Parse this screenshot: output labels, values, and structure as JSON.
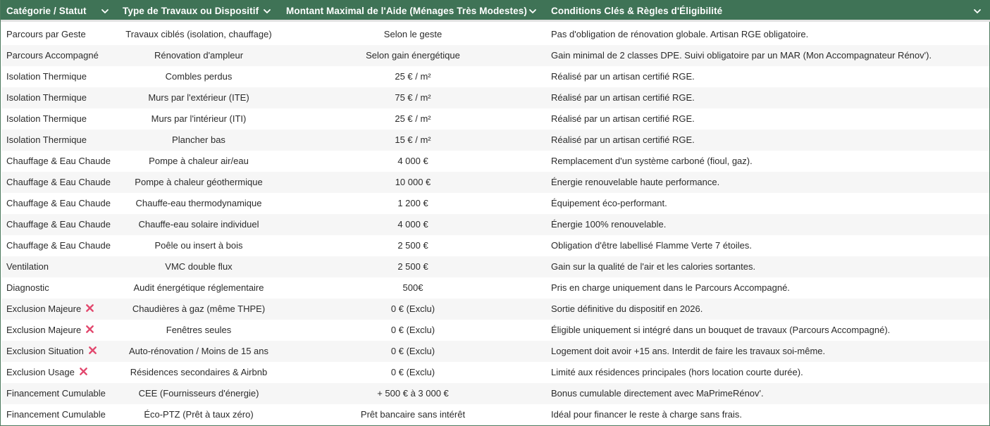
{
  "table": {
    "columns": [
      "Catégorie / Statut",
      "Type de Travaux ou Dispositif",
      "Montant Maximal de l'Aide (Ménages Très Modestes)",
      "Conditions Clés & Règles d'Éligibilité"
    ],
    "header_bg": "#3f7356",
    "exclusion_icon": "cross-mark-icon",
    "exclusion_color": "#e2476d",
    "rows": [
      {
        "category": "Parcours par Geste",
        "work": "Travaux ciblés (isolation, chauffage)",
        "amount": "Selon le geste",
        "conditions": "Pas d'obligation de rénovation globale. Artisan RGE obligatoire.",
        "excluded": false
      },
      {
        "category": "Parcours Accompagné",
        "work": "Rénovation d'ampleur",
        "amount": "Selon gain énergétique",
        "conditions": "Gain minimal de 2 classes DPE. Suivi obligatoire par un MAR (Mon Accompagnateur Rénov').",
        "excluded": false
      },
      {
        "category": "Isolation Thermique",
        "work": "Combles perdus",
        "amount": "25 € / m²",
        "conditions": "Réalisé par un artisan certifié RGE.",
        "excluded": false
      },
      {
        "category": "Isolation Thermique",
        "work": "Murs par l'extérieur (ITE)",
        "amount": "75 € / m²",
        "conditions": "Réalisé par un artisan certifié RGE.",
        "excluded": false
      },
      {
        "category": "Isolation Thermique",
        "work": "Murs par l'intérieur (ITI)",
        "amount": "25 € / m²",
        "conditions": "Réalisé par un artisan certifié RGE.",
        "excluded": false
      },
      {
        "category": "Isolation Thermique",
        "work": "Plancher bas",
        "amount": "15 € / m²",
        "conditions": "Réalisé par un artisan certifié RGE.",
        "excluded": false
      },
      {
        "category": "Chauffage & Eau Chaude",
        "work": "Pompe à chaleur air/eau",
        "amount": "4 000 €",
        "conditions": "Remplacement d'un système carboné (fioul, gaz).",
        "excluded": false
      },
      {
        "category": "Chauffage & Eau Chaude",
        "work": "Pompe à chaleur géothermique",
        "amount": "10 000 €",
        "conditions": "Énergie renouvelable haute performance.",
        "excluded": false
      },
      {
        "category": "Chauffage & Eau Chaude",
        "work": "Chauffe-eau thermodynamique",
        "amount": "1 200 €",
        "conditions": "Équipement éco-performant.",
        "excluded": false
      },
      {
        "category": "Chauffage & Eau Chaude",
        "work": "Chauffe-eau solaire individuel",
        "amount": "4 000 €",
        "conditions": "Énergie 100% renouvelable.",
        "excluded": false
      },
      {
        "category": "Chauffage & Eau Chaude",
        "work": "Poêle ou insert à bois",
        "amount": "2 500 €",
        "conditions": "Obligation d'être labellisé Flamme Verte 7 étoiles.",
        "excluded": false
      },
      {
        "category": "Ventilation",
        "work": "VMC double flux",
        "amount": "2 500 €",
        "conditions": "Gain sur la qualité de l'air et les calories sortantes.",
        "excluded": false
      },
      {
        "category": "Diagnostic",
        "work": "Audit énergétique réglementaire",
        "amount": "500€",
        "conditions": "Pris en charge uniquement dans le Parcours Accompagné.",
        "excluded": false
      },
      {
        "category": "Exclusion Majeure",
        "work": "Chaudières à gaz (même THPE)",
        "amount": "0 € (Exclu)",
        "conditions": "Sortie définitive du dispositif en 2026.",
        "excluded": true
      },
      {
        "category": "Exclusion Majeure",
        "work": "Fenêtres seules",
        "amount": "0 € (Exclu)",
        "conditions": "Éligible uniquement si intégré dans un bouquet de travaux (Parcours Accompagné).",
        "excluded": true
      },
      {
        "category": "Exclusion Situation",
        "work": "Auto-rénovation / Moins de 15 ans",
        "amount": "0 € (Exclu)",
        "conditions": "Logement doit avoir +15 ans. Interdit de faire les travaux soi-même.",
        "excluded": true
      },
      {
        "category": "Exclusion Usage",
        "work": "Résidences secondaires & Airbnb",
        "amount": "0 € (Exclu)",
        "conditions": "Limité aux résidences principales (hors location courte durée).",
        "excluded": true
      },
      {
        "category": "Financement Cumulable",
        "work": "CEE (Fournisseurs d'énergie)",
        "amount": "+ 500 € à 3 000 €",
        "conditions": "Bonus cumulable directement avec MaPrimeRénov'.",
        "excluded": false
      },
      {
        "category": "Financement Cumulable",
        "work": "Éco-PTZ (Prêt à taux zéro)",
        "amount": "Prêt bancaire sans intérêt",
        "conditions": "Idéal pour financer le reste à charge sans frais.",
        "excluded": false
      }
    ]
  }
}
